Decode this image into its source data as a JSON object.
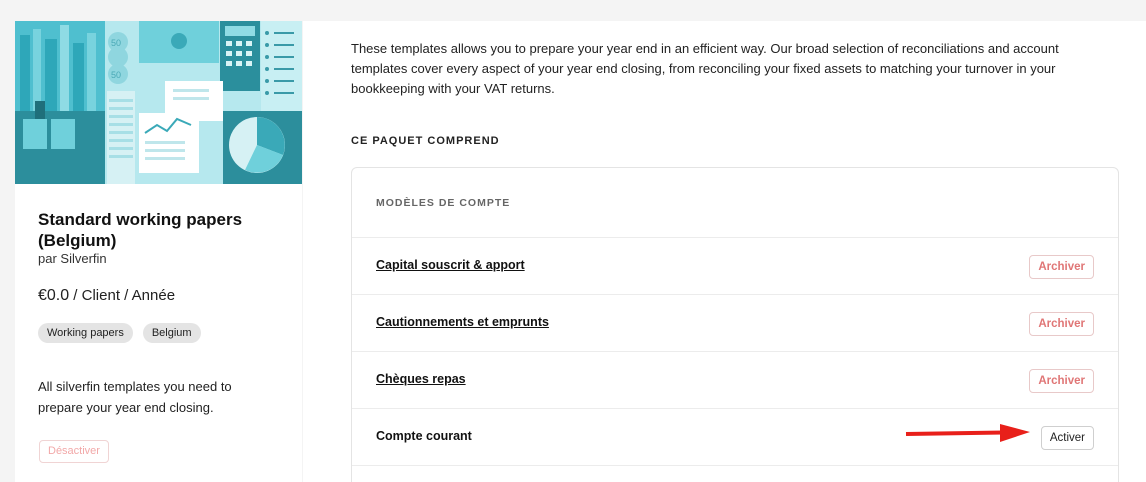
{
  "card": {
    "title": "Standard working papers (Belgium)",
    "author": "par Silverfin",
    "price_amount": "€0.0",
    "price_unit": " / Client / Année",
    "tags": [
      "Working papers",
      "Belgium"
    ],
    "description": "All silverfin templates you need to prepare your year end closing.",
    "deactivate_label": "Désactiver"
  },
  "main": {
    "intro": "These templates allows you to prepare your year end in an efficient way. Our broad selection of reconciliations and account templates cover every aspect of your year end closing, from reconciling your fixed assets to matching your turnover in your bookkeeping with your VAT returns.",
    "section_heading": "CE PAQUET COMPREND",
    "models_heading": "MODÈLES DE COMPTE",
    "rows": [
      {
        "label": "Capital souscrit & apport",
        "action": "Archiver"
      },
      {
        "label": "Cautionnements et emprunts",
        "action": "Archiver"
      },
      {
        "label": "Chèques repas",
        "action": "Archiver"
      },
      {
        "label": "Compte courant",
        "action": "Activer"
      }
    ]
  },
  "colors": {
    "hero_bg": "#5fc9d6",
    "accent_dark": "#2c8e9c",
    "archive_red": "#e07676",
    "arrow_red": "#e8201a"
  },
  "hero": {
    "coin_label": "50"
  }
}
